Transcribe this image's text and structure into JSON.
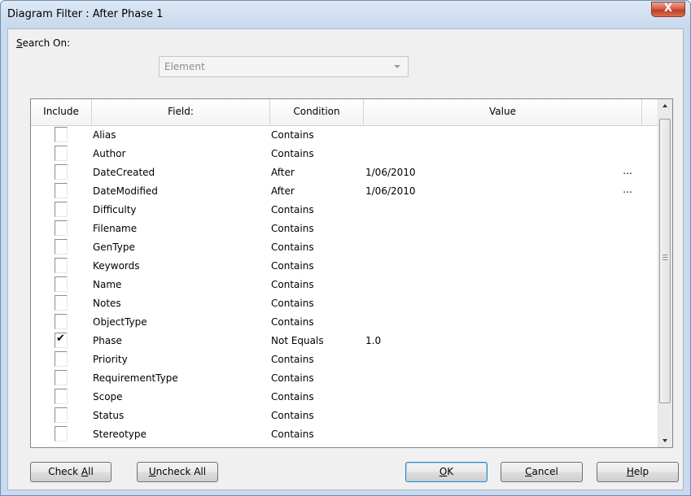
{
  "window": {
    "title": "Diagram Filter : After Phase 1",
    "close_label": "X"
  },
  "search": {
    "label_prefix": "",
    "label_accel": "S",
    "label_rest": "earch On:",
    "value": "Element"
  },
  "grid": {
    "headers": {
      "include": "Include",
      "field": "Field:",
      "condition": "Condition",
      "value": "Value"
    },
    "rows": [
      {
        "checked": false,
        "field": "Alias",
        "condition": "Contains",
        "value": "",
        "has_ellipsis": false
      },
      {
        "checked": false,
        "field": "Author",
        "condition": "Contains",
        "value": "",
        "has_ellipsis": false
      },
      {
        "checked": false,
        "field": "DateCreated",
        "condition": "After",
        "value": "1/06/2010",
        "has_ellipsis": true
      },
      {
        "checked": false,
        "field": "DateModified",
        "condition": "After",
        "value": "1/06/2010",
        "has_ellipsis": true
      },
      {
        "checked": false,
        "field": "Difficulty",
        "condition": "Contains",
        "value": "",
        "has_ellipsis": false
      },
      {
        "checked": false,
        "field": "Filename",
        "condition": "Contains",
        "value": "",
        "has_ellipsis": false
      },
      {
        "checked": false,
        "field": "GenType",
        "condition": "Contains",
        "value": "",
        "has_ellipsis": false
      },
      {
        "checked": false,
        "field": "Keywords",
        "condition": "Contains",
        "value": "",
        "has_ellipsis": false
      },
      {
        "checked": false,
        "field": "Name",
        "condition": "Contains",
        "value": "",
        "has_ellipsis": false
      },
      {
        "checked": false,
        "field": "Notes",
        "condition": "Contains",
        "value": "",
        "has_ellipsis": false
      },
      {
        "checked": false,
        "field": "ObjectType",
        "condition": "Contains",
        "value": "",
        "has_ellipsis": false
      },
      {
        "checked": true,
        "field": "Phase",
        "condition": "Not Equals",
        "value": "1.0",
        "has_ellipsis": false
      },
      {
        "checked": false,
        "field": "Priority",
        "condition": "Contains",
        "value": "",
        "has_ellipsis": false
      },
      {
        "checked": false,
        "field": "RequirementType",
        "condition": "Contains",
        "value": "",
        "has_ellipsis": false
      },
      {
        "checked": false,
        "field": "Scope",
        "condition": "Contains",
        "value": "",
        "has_ellipsis": false
      },
      {
        "checked": false,
        "field": "Status",
        "condition": "Contains",
        "value": "",
        "has_ellipsis": false
      },
      {
        "checked": false,
        "field": "Stereotype",
        "condition": "Contains",
        "value": "",
        "has_ellipsis": false
      }
    ],
    "check_glyph": "✔",
    "ellipsis_glyph": "..."
  },
  "buttons": {
    "check_all": {
      "pre": "Check ",
      "accel": "A",
      "post": "ll"
    },
    "uncheck_all": {
      "pre": "",
      "accel": "U",
      "post": "ncheck All"
    },
    "ok": {
      "pre": "",
      "accel": "O",
      "post": "K"
    },
    "cancel": {
      "pre": "",
      "accel": "C",
      "post": "ancel"
    },
    "help": {
      "pre": "",
      "accel": "H",
      "post": "elp"
    }
  }
}
